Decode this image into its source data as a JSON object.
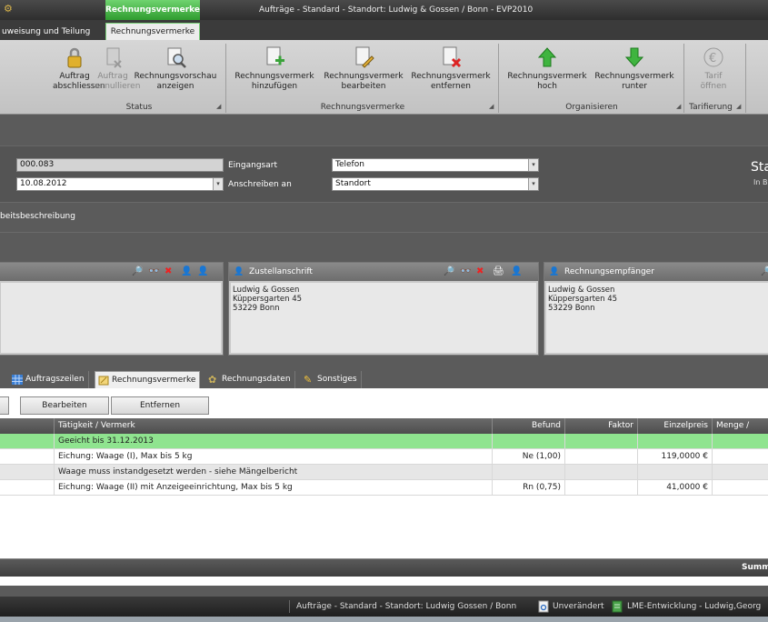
{
  "titlebar": {
    "context_tab": "Rechnungsvermerke",
    "window_title": "Aufträge - Standard - Standort: Ludwig & Gossen / Bonn - EVP2010"
  },
  "tabs": {
    "left_partial": "uweisung und Teilung",
    "active": "Rechnungsvermerke"
  },
  "ribbon": {
    "buttons": {
      "auftrag_abschliessen": [
        "Auftrag",
        "abschliessen"
      ],
      "auftrag_annullieren": [
        "Auftrag",
        "annullieren"
      ],
      "rechnungsvorschau": [
        "Rechnungsvorschau",
        "anzeigen"
      ],
      "rv_hinzufuegen": [
        "Rechnungsvermerk",
        "hinzufügen"
      ],
      "rv_bearbeiten": [
        "Rechnungsvermerk",
        "bearbeiten"
      ],
      "rv_entfernen": [
        "Rechnungsvermerk",
        "entfernen"
      ],
      "rv_hoch": [
        "Rechnungsvermerk",
        "hoch"
      ],
      "rv_runter": [
        "Rechnungsvermerk",
        "runter"
      ],
      "tarif_oeffnen": [
        "Tarif",
        "öffnen"
      ]
    },
    "groups": {
      "status": "Status",
      "rechnungsvermerke": "Rechnungsvermerke",
      "organisieren": "Organisieren",
      "tarifierung": "Tarifierung"
    }
  },
  "form": {
    "auftragsnr_value": "000.083",
    "datum_value": "10.08.2012",
    "eingangsart_label": "Eingangsart",
    "eingangsart_value": "Telefon",
    "anschreiben_label": "Anschreiben an",
    "anschreiben_value": "Standort",
    "status_big": "Sta",
    "status_small": "In B",
    "arbeitsbeschreibung": "beitsbeschreibung"
  },
  "addresses": {
    "zustell": {
      "title": "Zustellanschrift",
      "lines": [
        "Ludwig & Gossen",
        "Küppersgarten 45",
        "53229 Bonn"
      ]
    },
    "rechnung": {
      "title": "Rechnungsempfänger",
      "lines": [
        "Ludwig & Gossen",
        "Küppersgarten 45",
        "53229 Bonn"
      ]
    }
  },
  "lower_tabs": {
    "auftragszeilen": "Auftragszeilen",
    "rechnungsvermerke": "Rechnungsvermerke",
    "rechnungsdaten": "Rechnungsdaten",
    "sonstiges": "Sonstiges"
  },
  "buttons": {
    "bearbeiten": "Bearbeiten",
    "entfernen": "Entfernen"
  },
  "grid": {
    "headers": {
      "taetigkeit": "Tätigkeit / Vermerk",
      "befund": "Befund",
      "faktor": "Faktor",
      "einzelpreis": "Einzelpreis",
      "menge": "Menge / Dau"
    },
    "rows": [
      {
        "taetigkeit": "Geeicht bis 31.12.2013",
        "befund": "",
        "faktor": "",
        "einzelpreis": "",
        "menge": ""
      },
      {
        "taetigkeit": "Eichung: Waage (I), Max bis 5 kg",
        "befund": "Ne (1,00)",
        "faktor": "",
        "einzelpreis": "119,0000 €",
        "menge": ""
      },
      {
        "taetigkeit": "Waage muss instandgesetzt werden - siehe Mängelbericht",
        "befund": "",
        "faktor": "",
        "einzelpreis": "",
        "menge": ""
      },
      {
        "taetigkeit": "Eichung: Waage (II) mit Anzeigeeinrichtung, Max bis 5 kg",
        "befund": "Rn (0,75)",
        "faktor": "",
        "einzelpreis": "41,0000 €",
        "menge": ""
      }
    ]
  },
  "summary_label": "Summ",
  "statusbar": {
    "context": "Aufträge - Standard - Standort: Ludwig  Gossen / Bonn",
    "state": "Unverändert",
    "env": "LME-Entwicklung - Ludwig,Georg"
  },
  "colors": {
    "accent_green": "#7be07b",
    "highlight_row": "#8fe48f",
    "alt_row": "#e6e6e6"
  }
}
